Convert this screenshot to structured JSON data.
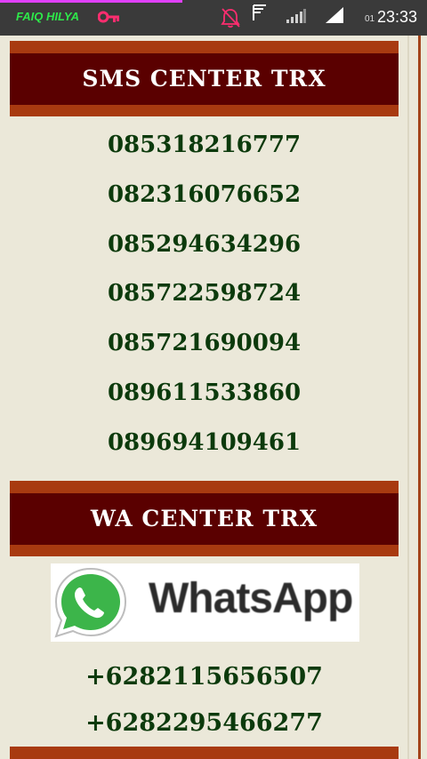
{
  "status_bar": {
    "carrier": "FAIQ HILYA",
    "sim": "01",
    "time": "23:33",
    "icons": [
      "key-icon",
      "notifications-off-icon",
      "signal-outline-icon",
      "signal-bars-icon",
      "wifi-icon"
    ]
  },
  "sms_section": {
    "title": "SMS CENTER TRX",
    "numbers": [
      "085318216777",
      "082316076652",
      "085294634296",
      "085722598724",
      "085721690094",
      "089611533860",
      "089694109461"
    ]
  },
  "wa_section": {
    "title": "WA CENTER TRX",
    "logo_text": "WhatsApp",
    "numbers": [
      "+6282115656507",
      "+6282295466277"
    ]
  },
  "colors": {
    "banner_outer": "#a83a10",
    "banner_inner": "#5a0000",
    "number_text": "#0c3a0c",
    "page_bg": "#ebe8d9",
    "whatsapp_green": "#3cb54a"
  }
}
